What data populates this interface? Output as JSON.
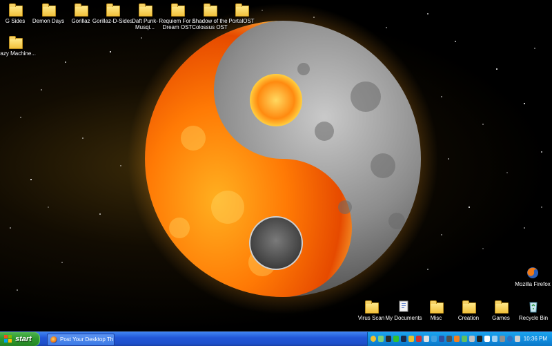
{
  "desktop": {
    "icons_top": [
      {
        "name": "icon-g-sides",
        "label": "G Sides"
      },
      {
        "name": "icon-demon-days",
        "label": "Demon Days"
      },
      {
        "name": "icon-gorillaz",
        "label": "Gorillaz"
      },
      {
        "name": "icon-gorillaz-d-sides",
        "label": "Gorillaz-D-Sides"
      },
      {
        "name": "icon-daft-punk",
        "label": "Daft Punk-Musqi..."
      },
      {
        "name": "icon-requiem",
        "label": "Requiem For A Dream OST"
      },
      {
        "name": "icon-shadow-colossus",
        "label": "Shadow of the Colossus OST"
      },
      {
        "name": "icon-portal-ost",
        "label": "PortalOST"
      }
    ],
    "icon_crazy": {
      "label": "Crazy Machine..."
    },
    "icons_bottom": [
      {
        "label": "Virus Scan",
        "type": "folder"
      },
      {
        "label": "My Documents",
        "type": "documents"
      },
      {
        "label": "Misc",
        "type": "folder"
      },
      {
        "label": "Creation",
        "type": "folder"
      },
      {
        "label": "Games",
        "type": "folder"
      },
      {
        "label": "Recycle Bin",
        "type": "recycle"
      }
    ],
    "firefox_icon": {
      "label": "Mozilla Firefox"
    }
  },
  "taskbar": {
    "start_label": "start",
    "window_button": "Post Your Desktop Th...",
    "clock": "10:36 PM"
  },
  "colors": {
    "taskbar_blue": "#2258d8",
    "start_green": "#2f9a2f",
    "tray_blue": "#118de0"
  }
}
